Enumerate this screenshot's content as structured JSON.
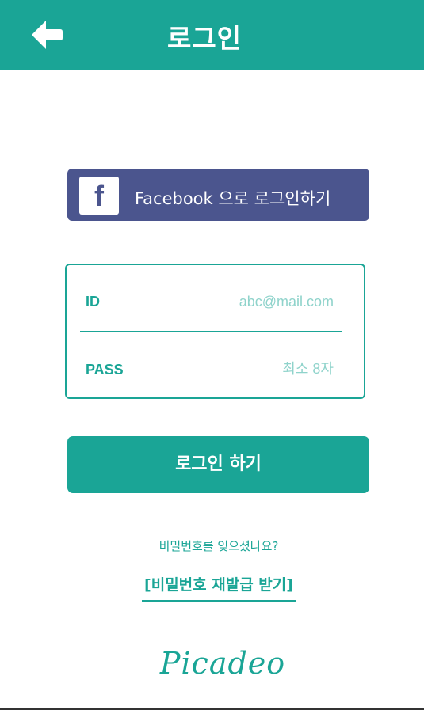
{
  "header": {
    "title": "로그인",
    "back_icon": "arrow-left-icon",
    "background": "#1aa596"
  },
  "facebook": {
    "logo_letter": "f",
    "label": "Facebook 으로 로그인하기",
    "background": "#4b558e"
  },
  "login_form": {
    "id_label": "ID",
    "id_placeholder": "abc@mail.com",
    "pass_label": "PASS",
    "pass_placeholder": "최소 8자"
  },
  "login_button": {
    "label": "로그인 하기"
  },
  "forgot": {
    "question": "비밀번호를 잊으셨나요?",
    "reissue_link": "[비밀번호 재발급 받기]"
  },
  "brand": {
    "logo_text": "Picadeo"
  },
  "colors": {
    "accent": "#1aa596",
    "accent_light": "#8fd3cb",
    "facebook": "#4b558e"
  }
}
